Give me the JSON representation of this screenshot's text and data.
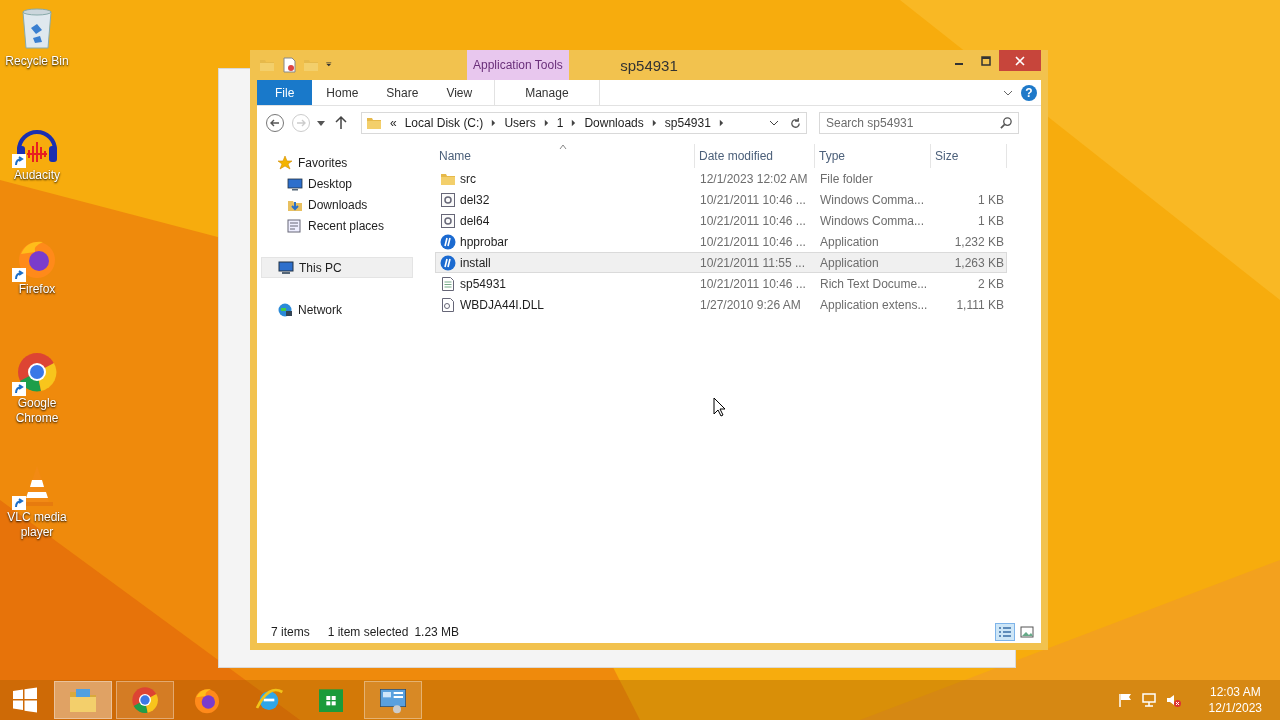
{
  "desktop_icons": [
    {
      "label": "Recycle Bin",
      "kind": "recycle",
      "shortcut": false
    },
    {
      "label": "Audacity",
      "kind": "audacity",
      "shortcut": true
    },
    {
      "label": "Firefox",
      "kind": "firefox",
      "shortcut": true
    },
    {
      "label": "Google Chrome",
      "kind": "chrome",
      "shortcut": true
    },
    {
      "label": "VLC media player",
      "kind": "vlc",
      "shortcut": true
    }
  ],
  "window": {
    "title": "sp54931",
    "context_group": "Application Tools",
    "help_button": "?",
    "ribbon_tabs": [
      {
        "label": "File",
        "kind": "file"
      },
      {
        "label": "Home",
        "kind": "tab"
      },
      {
        "label": "Share",
        "kind": "tab"
      },
      {
        "label": "View",
        "kind": "tab"
      },
      {
        "label": "Manage",
        "kind": "context"
      }
    ],
    "address": {
      "overflow": "«",
      "crumbs": [
        "Local Disk (C:)",
        "Users",
        "1",
        "Downloads",
        "sp54931"
      ]
    },
    "search": {
      "placeholder": "Search sp54931"
    },
    "sidebar": [
      {
        "label": "Favorites",
        "kind": "star",
        "selected": false,
        "children": [
          {
            "label": "Desktop",
            "kind": "desktop",
            "selected": false
          },
          {
            "label": "Downloads",
            "kind": "downloads",
            "selected": false
          },
          {
            "label": "Recent places",
            "kind": "recent",
            "selected": false
          }
        ]
      },
      {
        "label": "This PC",
        "kind": "pc",
        "selected": true
      },
      {
        "label": "Network",
        "kind": "network",
        "selected": false
      }
    ],
    "columns": [
      "Name",
      "Date modified",
      "Type",
      "Size"
    ],
    "rows": [
      {
        "name": "src",
        "date": "12/1/2023 12:02 AM",
        "type": "File folder",
        "kind": "folder",
        "selected": false
      },
      {
        "name": "del32",
        "date": "10/21/2011 10:46 ...",
        "type": "Windows Comma...",
        "size": "1 KB",
        "kind": "script",
        "selected": false
      },
      {
        "name": "del64",
        "date": "10/21/2011 10:46 ...",
        "type": "Windows Comma...",
        "size": "1 KB",
        "kind": "script",
        "selected": false
      },
      {
        "name": "hpprobar",
        "date": "10/21/2011 10:46 ...",
        "type": "Application",
        "size": "1,232 KB",
        "kind": "app",
        "selected": false
      },
      {
        "name": "install",
        "date": "10/21/2011 11:55 ...",
        "type": "Application",
        "size": "1,263 KB",
        "kind": "app",
        "selected": true
      },
      {
        "name": "sp54931",
        "date": "10/21/2011 10:46 ...",
        "type": "Rich Text Docume...",
        "size": "2 KB",
        "kind": "document",
        "selected": false
      },
      {
        "name": "WBDJA44I.DLL",
        "date": "1/27/2010 9:26 AM",
        "type": "Application extens...",
        "size": "1,111 KB",
        "kind": "dll",
        "selected": false
      }
    ],
    "status_bar": {
      "item_count": "7 items",
      "selection": "1 item selected",
      "selection_size": "1.23 MB",
      "views": [
        {
          "kind": "details",
          "selected": true
        },
        {
          "kind": "large",
          "selected": false
        }
      ]
    }
  },
  "taskbar": {
    "apps": [
      {
        "kind": "explorer",
        "running": true,
        "selected": true
      },
      {
        "kind": "chrome",
        "running": true,
        "selected": false
      },
      {
        "kind": "firefox",
        "running": false,
        "selected": false
      },
      {
        "kind": "ie",
        "running": false,
        "selected": false
      },
      {
        "kind": "store",
        "running": false,
        "selected": false
      },
      {
        "kind": "control",
        "running": true,
        "selected": false
      }
    ],
    "tray": [
      {
        "kind": "flag"
      },
      {
        "kind": "network"
      },
      {
        "kind": "volume-muted"
      }
    ],
    "time": "12:03 AM",
    "date": "12/1/2023"
  }
}
